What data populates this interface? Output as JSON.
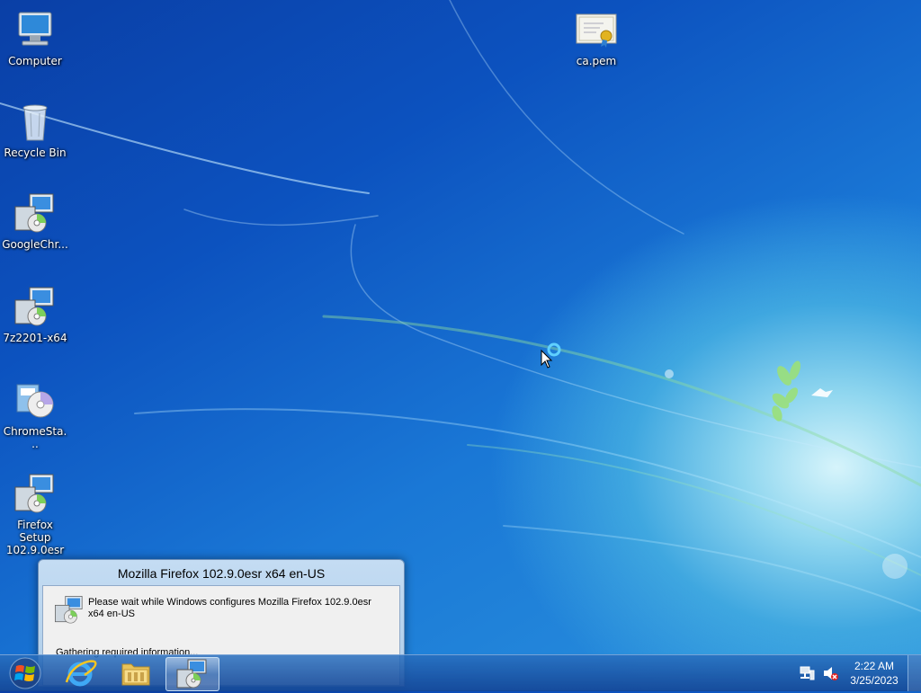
{
  "desktop": {
    "icons": [
      {
        "label": "Computer",
        "icon": "computer-icon"
      },
      {
        "label": "Recycle Bin",
        "icon": "recycle-bin-icon"
      },
      {
        "label": "GoogleChr...",
        "icon": "installer-icon"
      },
      {
        "label": "7z2201-x64",
        "icon": "installer-icon"
      },
      {
        "label": "ChromeSta...",
        "icon": "setup-cd-icon"
      },
      {
        "label": "Firefox Setup 102.9.0esr",
        "icon": "installer-icon"
      },
      {
        "label": "ca.pem",
        "icon": "certificate-icon"
      }
    ]
  },
  "dialog": {
    "title": "Mozilla Firefox 102.9.0esr x64 en-US",
    "message": "Please wait while Windows configures Mozilla Firefox 102.9.0esr x64 en-US",
    "status": "Gathering required information..."
  },
  "taskbar": {
    "start_icon": "windows-logo-icon",
    "pinned": [
      {
        "name": "internet-explorer",
        "icon": "internet-explorer-icon"
      },
      {
        "name": "windows-explorer",
        "icon": "folder-icon"
      },
      {
        "name": "installer",
        "icon": "installer-icon",
        "active": true
      }
    ],
    "tray": {
      "network_icon": "network-icon",
      "volume_icon": "volume-muted-icon",
      "time": "2:22 AM",
      "date": "3/25/2023"
    }
  },
  "colors": {
    "accent": "#1a78d6",
    "taskbar": "#2a6cb8"
  }
}
